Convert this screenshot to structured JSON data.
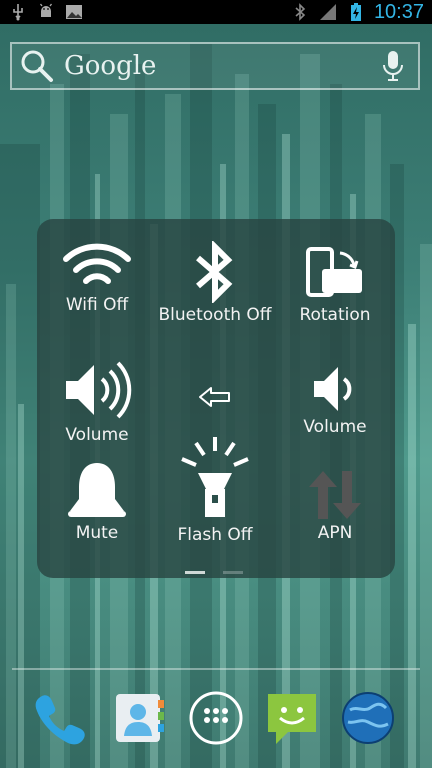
{
  "status_bar": {
    "time": "10:37",
    "left_icons": [
      "usb-icon",
      "android-debug-icon",
      "image-icon"
    ],
    "right_icons": [
      "bluetooth-icon",
      "signal-icon",
      "battery-charging-icon"
    ],
    "clock_color": "#33b5e5"
  },
  "search_bar": {
    "label": "Google",
    "left_icon": "search-icon",
    "right_icon": "microphone-icon"
  },
  "toggles": [
    {
      "label": "Wifi Off",
      "icon": "wifi-icon"
    },
    {
      "label": "Bluetooth Off",
      "icon": "bluetooth-icon"
    },
    {
      "label": "Rotation",
      "icon": "rotation-icon"
    },
    {
      "label": "Volume",
      "icon": "volume-up-icon"
    },
    {
      "label": "",
      "icon": "arrow-left-icon"
    },
    {
      "label": "Volume",
      "icon": "volume-down-icon"
    },
    {
      "label": "Mute",
      "icon": "bell-icon"
    },
    {
      "label": "Flash Off",
      "icon": "flashlight-icon"
    },
    {
      "label": "APN",
      "icon": "apn-arrows-icon"
    }
  ],
  "pager": {
    "pages": 2,
    "current": 1
  },
  "dock": [
    {
      "icon": "phone-icon"
    },
    {
      "icon": "contacts-icon"
    },
    {
      "icon": "app-drawer-icon"
    },
    {
      "icon": "messaging-icon"
    },
    {
      "icon": "browser-globe-icon"
    }
  ]
}
